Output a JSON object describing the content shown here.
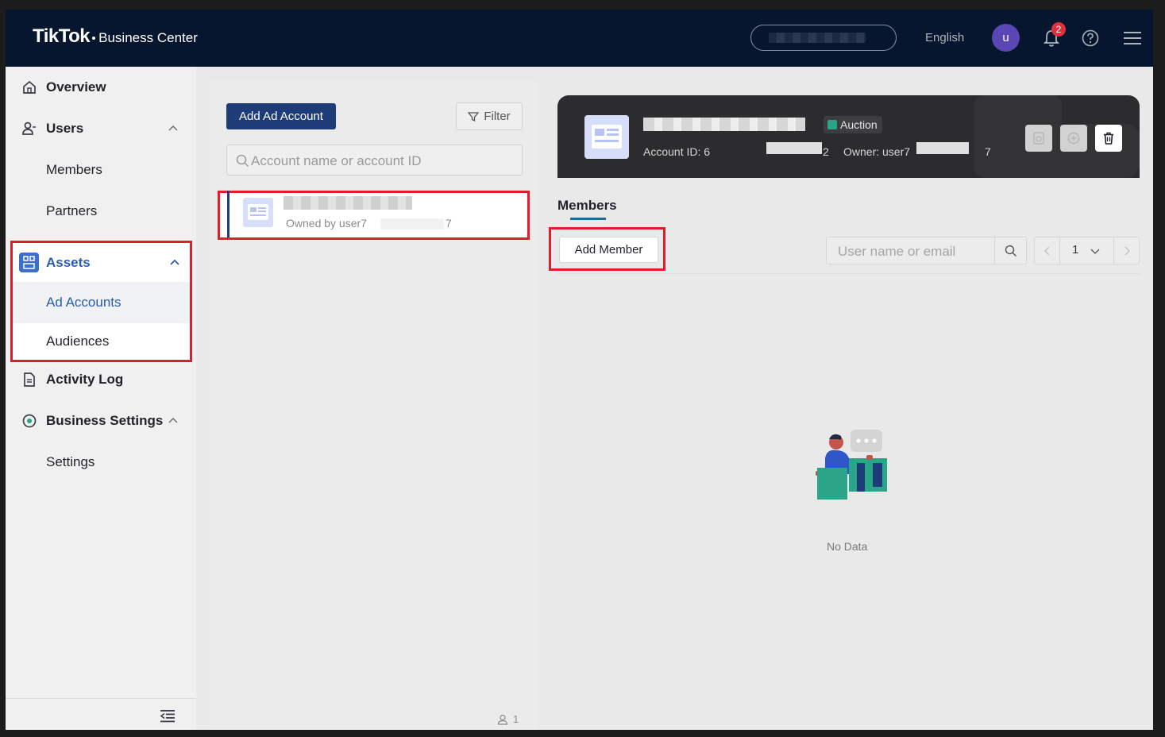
{
  "topbar": {
    "logo_main": "TikTok",
    "logo_sub": "Business Center",
    "language": "English",
    "avatar_letter": "u",
    "notification_count": "2"
  },
  "sidebar": {
    "items": [
      {
        "label": "Overview",
        "icon": "home-icon"
      },
      {
        "label": "Users",
        "icon": "users-icon",
        "expanded": true
      },
      {
        "label": "Members"
      },
      {
        "label": "Partners"
      },
      {
        "label": "Assets",
        "icon": "assets-icon",
        "expanded": true,
        "active": true
      },
      {
        "label": "Ad Accounts",
        "selected": true
      },
      {
        "label": "Audiences"
      },
      {
        "label": "Activity Log",
        "icon": "document-icon"
      },
      {
        "label": "Business Settings",
        "icon": "settings-icon",
        "expanded": true
      },
      {
        "label": "Settings"
      }
    ]
  },
  "ad_accounts_panel": {
    "add_button": "Add Ad Account",
    "filter_button": "Filter",
    "search_placeholder": "Account name or account ID",
    "account": {
      "owner_prefix": "Owned by user7",
      "owner_suffix": "7"
    },
    "count": "1"
  },
  "account_header": {
    "badge": "Auction",
    "account_id_prefix": "Account ID: 6",
    "account_id_suffix": "2",
    "owner_prefix": "Owner: user7",
    "owner_suffix": "7"
  },
  "members": {
    "tab": "Members",
    "add_button": "Add Member",
    "search_placeholder": "User name or email",
    "page": "1",
    "empty_text": "No Data"
  },
  "colors": {
    "topbar": "#06162e",
    "primary_button": "#1e3c78",
    "active_nav": "#2a5db0",
    "highlight_box": "#e01e2a",
    "badge": "#e0313b",
    "avatar": "#5a46b5",
    "auction_tag": "#2aa588"
  }
}
